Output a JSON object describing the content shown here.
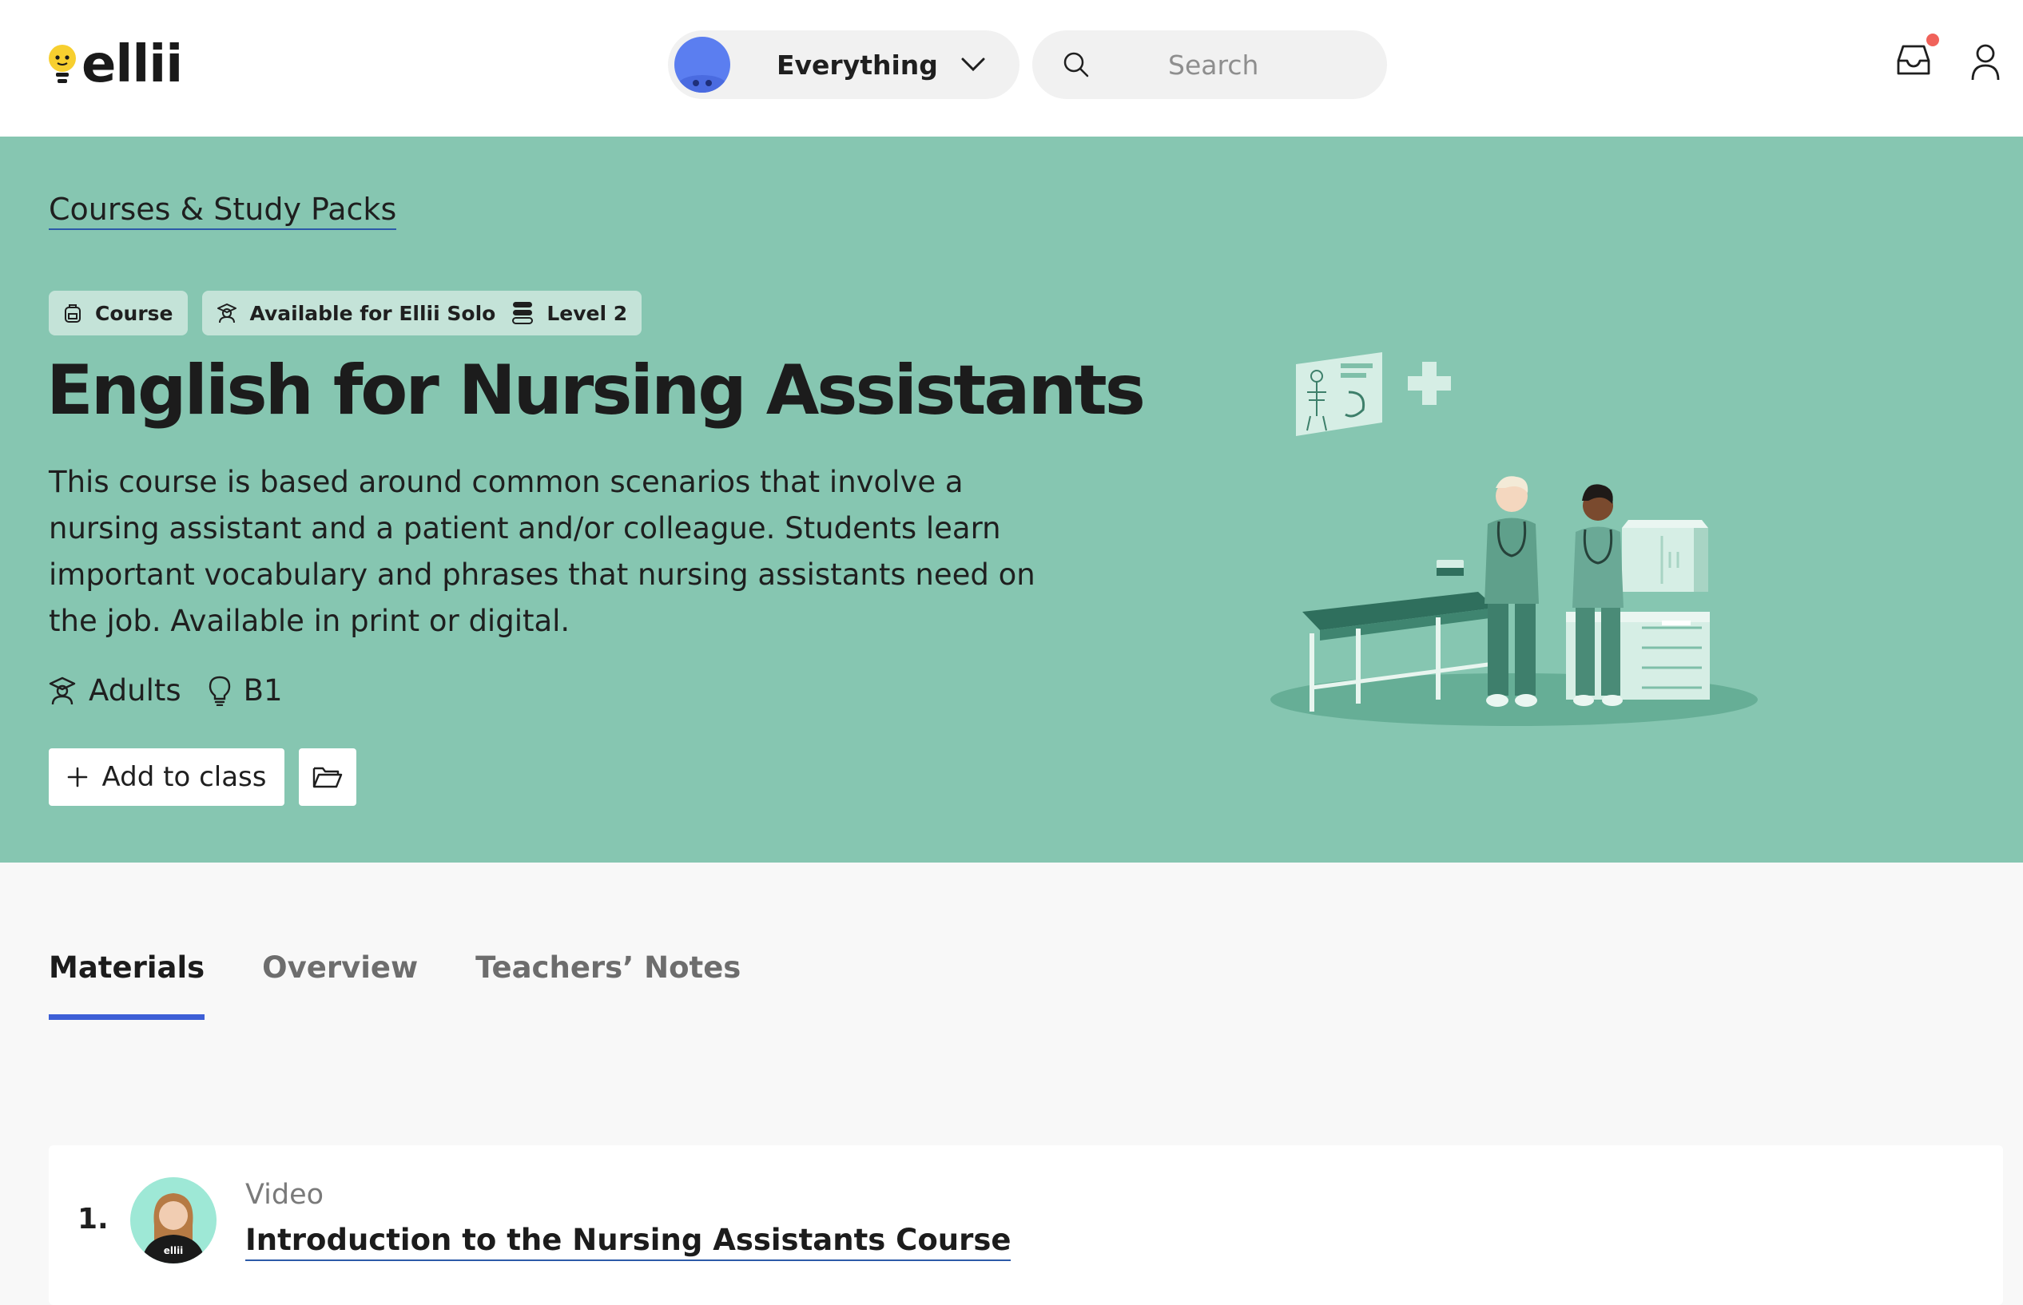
{
  "brand": {
    "logo_text": "ellii"
  },
  "header": {
    "filter_label": "Everything",
    "search_placeholder": "Search"
  },
  "hero": {
    "breadcrumb": "Courses & Study Packs",
    "badges": {
      "type": "Course",
      "availability": "Available for Ellii Solo",
      "level": "Level 2"
    },
    "title": "English for Nursing Assistants",
    "description": "This course is based around common scenarios that involve a nursing assistant and a patient and/or colleague. Students learn important vocabulary and phrases that nursing assistants need on the job. Available in print or digital.",
    "audience": "Adults",
    "cefr_level": "B1",
    "add_button_label": "Add to class"
  },
  "tabs": [
    {
      "label": "Materials",
      "active": true
    },
    {
      "label": "Overview",
      "active": false
    },
    {
      "label": "Teachers’ Notes",
      "active": false
    }
  ],
  "materials": [
    {
      "number": "1.",
      "type": "Video",
      "title": "Introduction to the Nursing Assistants Course"
    }
  ],
  "colors": {
    "hero_bg": "#86c6b1",
    "badge_bg": "#c4e3d8",
    "tab_accent": "#3d5fd6",
    "notification": "#f0625a",
    "link_underline": "#2c5aa8"
  },
  "icons": {
    "filter": "blob-avatar-icon",
    "chevron": "chevron-down-icon",
    "search": "search-icon",
    "inbox": "inbox-icon",
    "user": "user-icon",
    "course": "backpack-icon",
    "availability": "student-icon",
    "level": "level-stack-icon",
    "audience": "student-icon",
    "cefr": "lightbulb-icon",
    "add": "plus-icon",
    "folder": "folder-open-icon"
  }
}
